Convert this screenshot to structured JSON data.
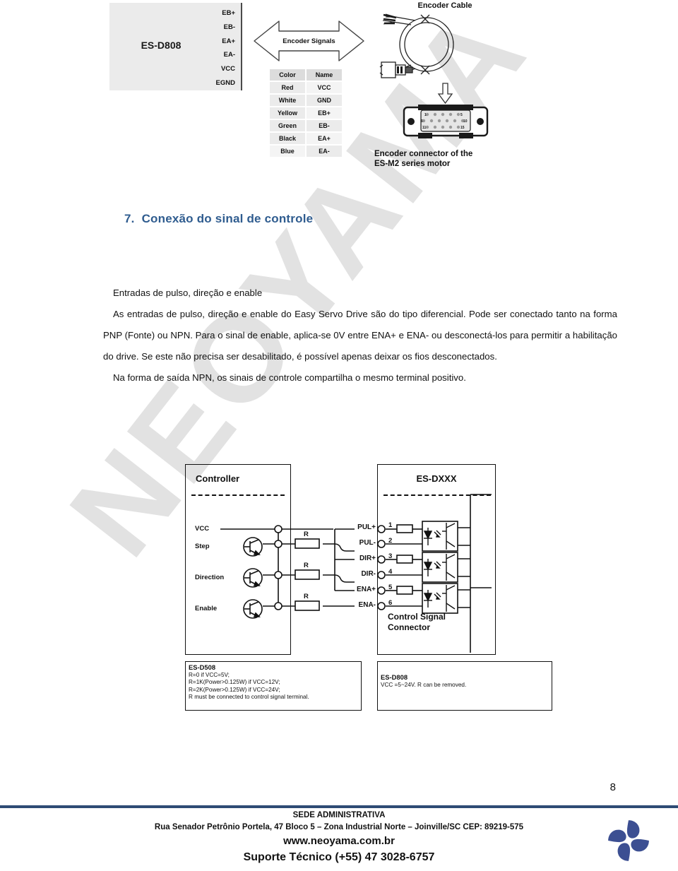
{
  "document": {
    "page_number": "8",
    "watermark": "NEOYAMA"
  },
  "encoder_figure": {
    "drive_label": "ES-D808",
    "drive_pins": [
      "EB+",
      "EB-",
      "EA+",
      "EA-",
      "VCC",
      "EGND"
    ],
    "arrow_label": "Encoder Signals",
    "wire_table": {
      "headers": [
        "Color",
        "Name"
      ],
      "rows": [
        [
          "Red",
          "VCC"
        ],
        [
          "White",
          "GND"
        ],
        [
          "Yellow",
          "EB+"
        ],
        [
          "Green",
          "EB-"
        ],
        [
          "Black",
          "EA+"
        ],
        [
          "Blue",
          "EA-"
        ]
      ]
    },
    "cable_caption_top": "Encoder Cable",
    "connector_caption_line1": "Encoder connector of the",
    "connector_caption_line2": "ES-M2 series motor",
    "connector_pin_numbers": [
      "1",
      "5",
      "6",
      "10",
      "11",
      "15"
    ]
  },
  "section": {
    "number": "7.",
    "title": "Conexão do sinal de controle",
    "title_color": "#2f5c8f"
  },
  "body": {
    "lead": "Entradas de pulso, direção e enable",
    "paragraph1": "As entradas de pulso, direção e enable do Easy Servo Drive são do tipo diferencial. Pode ser conectado tanto na forma PNP (Fonte) ou NPN. Para o sinal de enable, aplica-se 0V entre ENA+ e ENA- ou desconectá-los para permitir a habilitação do drive. Se este não precisa ser desabilitado, é possível apenas deixar os fios desconectados.",
    "paragraph2": "Na forma de saída NPN, os sinais de controle compartilha o mesmo terminal positivo."
  },
  "circuit_figure": {
    "controller_title": "Controller",
    "controller_signals": [
      "VCC",
      "Step",
      "Direction",
      "Enable"
    ],
    "resistor_labels": [
      "R",
      "R",
      "R"
    ],
    "drive_title": "ES-DXXX",
    "terminal_labels": [
      "PUL+",
      "PUL-",
      "DIR+",
      "DIR-",
      "ENA+",
      "ENA-"
    ],
    "pin_numbers": [
      "1",
      "2",
      "3",
      "4",
      "5",
      "6"
    ],
    "connector_caption_line1": "Control Signal",
    "connector_caption_line2": "Connector",
    "note_left": {
      "title": "ES-D508",
      "lines": [
        "R=0 if VCC=5V;",
        "R=1K(Power>0.125W) if VCC=12V;",
        "R=2K(Power>0.125W) if VCC=24V;",
        "R must be connected to control signal terminal."
      ]
    },
    "note_right": {
      "title": "ES-D808",
      "lines": [
        "VCC =5~24V. R can be removed."
      ]
    }
  },
  "footer": {
    "line1": "SEDE ADMINISTRATIVA",
    "line2": "Rua Senador Petrônio Portela, 47 Bloco 5 – Zona Industrial Norte – Joinville/SC CEP: 89219-575",
    "line3": "www.neoyama.com.br",
    "line4": "Suporte Técnico (+55) 47 3028-6757",
    "rule_color": "#2e4b74",
    "logo_color": "#3c4f92"
  }
}
